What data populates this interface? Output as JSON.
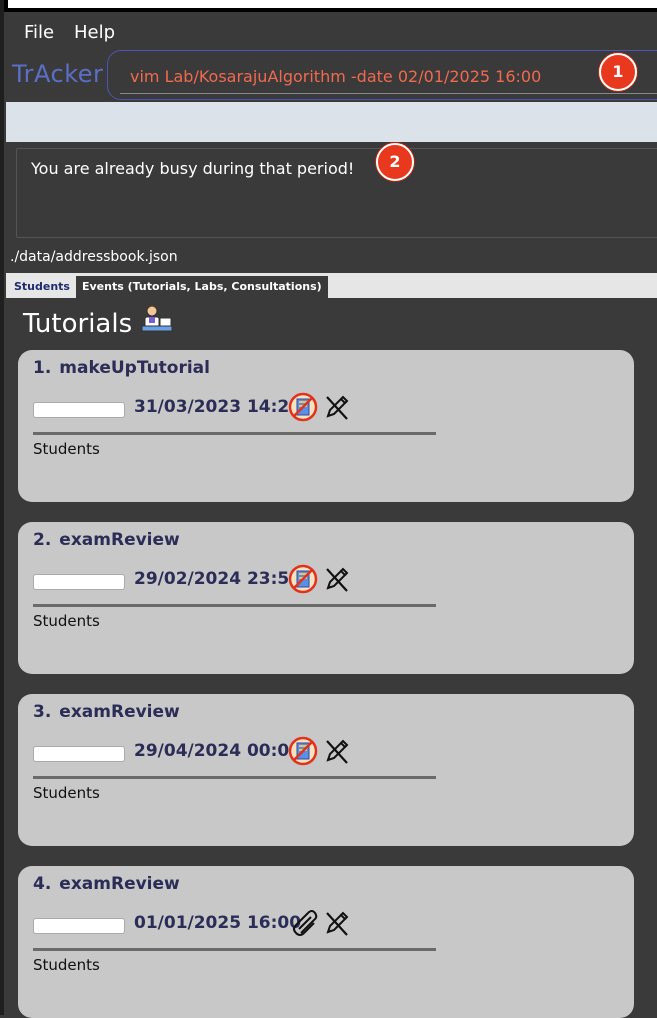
{
  "menu": {
    "file": "File",
    "help": "Help"
  },
  "app": {
    "brand": "TrAcker"
  },
  "command": {
    "value": "vim Lab/KosarajuAlgorithm -date 02/01/2025 16:00"
  },
  "badges": {
    "one": "1",
    "two": "2"
  },
  "result": {
    "message": "You are already busy during that period!"
  },
  "status": {
    "path": "./data/addressbook.json"
  },
  "tabs": [
    {
      "label": "Students"
    },
    {
      "label": "Events (Tutorials, Labs, Consultations)"
    }
  ],
  "panel": {
    "title": "Tutorials",
    "icon": "tutor-at-desk-icon"
  },
  "events": [
    {
      "index": "1.",
      "name": "makeUpTutorial",
      "date": "31/03/2023 14:23",
      "status_icon": "no-attachment-icon",
      "students": "Students"
    },
    {
      "index": "2.",
      "name": "examReview",
      "date": "29/02/2024 23:59",
      "status_icon": "no-attachment-icon",
      "students": "Students"
    },
    {
      "index": "3.",
      "name": "examReview",
      "date": "29/04/2024 00:00",
      "status_icon": "no-attachment-icon",
      "students": "Students"
    },
    {
      "index": "4.",
      "name": "examReview",
      "date": "01/01/2025 16:00",
      "status_icon": "paperclip-icon",
      "students": "Students"
    }
  ],
  "colors": {
    "brand": "#5c6fc7",
    "command_text": "#f06a4f",
    "badge": "#e8391f",
    "card": "#c8c8c8",
    "card_text": "#2b2d57"
  }
}
